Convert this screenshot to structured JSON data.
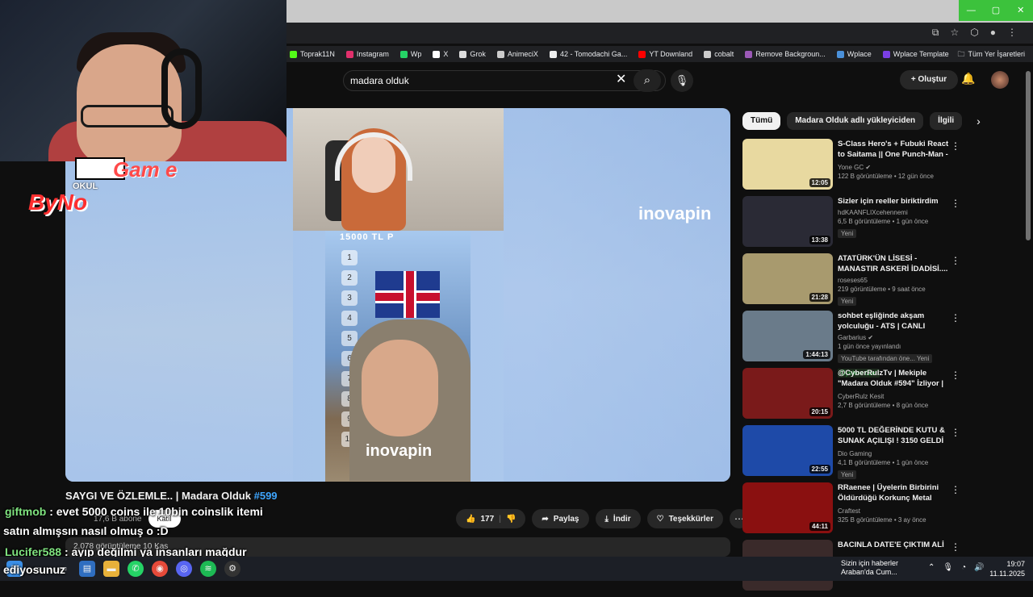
{
  "browser": {
    "window_controls": [
      "—",
      "▢",
      "✕"
    ],
    "bookmarks": [
      {
        "label": "Toprak11N",
        "color": "#53fc18"
      },
      {
        "label": "Instagram",
        "color": "#e1306c"
      },
      {
        "label": "Wp",
        "color": "#25d366"
      },
      {
        "label": "X",
        "color": "#ffffff"
      },
      {
        "label": "Grok",
        "color": "#ffffff"
      },
      {
        "label": "AnimeciX",
        "color": "#ffffff"
      },
      {
        "label": "42 - Tomodachi Ga...",
        "color": "#ffffff"
      },
      {
        "label": "YT Downland",
        "color": "#ff0000"
      },
      {
        "label": "cobalt",
        "color": "#ffffff"
      },
      {
        "label": "Remove Backgroun...",
        "color": "#9b59b6"
      },
      {
        "label": "Wplace",
        "color": "#4a90d9"
      },
      {
        "label": "Wplace Template",
        "color": "#7b3fe4"
      }
    ],
    "all_bookmarks": "Tüm Yer İşaretleri"
  },
  "header": {
    "search_value": "madara olduk",
    "create_label": "Oluştur"
  },
  "overlay": {
    "logo_okul": "OKUL",
    "logo_game": "Gam e",
    "logo_byno": "ByNo"
  },
  "video": {
    "reel_title": "15000 TL P",
    "reel_numbers": [
      "1",
      "2",
      "3",
      "4",
      "5",
      "6",
      "7",
      "8",
      "9",
      "10"
    ],
    "watermark": "inovapin",
    "watermark2": "inovapin",
    "title": "SAYGI VE ÖZLEMLE.. | Madara Olduk",
    "title_tag": "#599",
    "subscribers": "17,6 B abone",
    "join_label": "Katıl",
    "likes": "177",
    "share_label": "Paylaş",
    "download_label": "İndir",
    "thanks_label": "Teşekkürler",
    "description_meta": "2.078 görüntüleme  10 Kas"
  },
  "chat": [
    {
      "user": "giftmob",
      "text": ": evet 5000 coins ile 10bin coinslik itemi"
    },
    {
      "user": "",
      "text": "satın almışsın nasıl olmuş o :D"
    },
    {
      "user": "Lucifer588",
      "text": ": ayıp değilmi ya insanları mağdur"
    },
    {
      "user": "",
      "text": "ediyosunuz"
    }
  ],
  "chips": [
    "Tümü",
    "Madara Olduk adlı yükleyiciden",
    "İlgili"
  ],
  "related": [
    {
      "title": "S-Class Hero's + Fubuki React to Saitama || One Punch-Man - ...",
      "channel": "Yone GC ✔",
      "views": "122 B görüntüleme • 12 gün önce",
      "duration": "12:05",
      "thumb": "#e8d9a0",
      "badge": "",
      "member": ""
    },
    {
      "title": "Sizler için reeller biriktirdim",
      "channel": "hdKAANFLIXcehennemi",
      "views": "6,5 B görüntüleme • 1 gün önce",
      "duration": "13:38",
      "thumb": "#2a2a35",
      "badge": "Yeni",
      "member": ""
    },
    {
      "title": "ATATÜRK'ÜN LİSESİ - MANASTIR ASKERİ İDADİSİ....",
      "channel": "roseses65",
      "views": "219 görüntüleme • 9 saat önce",
      "duration": "21:28",
      "thumb": "#a89a6e",
      "badge": "Yeni",
      "member": ""
    },
    {
      "title": "sohbet eşliğinde akşam yolculuğu - ATS | CANLI",
      "channel": "Garbarius ✔",
      "views": "1 gün önce yayınlandı",
      "duration": "1:44:13",
      "thumb": "#6a7b8a",
      "badge": "YouTube tarafından öne...  Yeni",
      "member": "Üyelere özel"
    },
    {
      "title": "@CyberRulzTv | Mekiple \"Madara Olduk #594\" İzliyor | ...",
      "channel": "CyberRulz Kesit",
      "views": "2,7 B görüntüleme • 8 gün önce",
      "duration": "20:15",
      "thumb": "#7a1a1a",
      "badge": "",
      "member": ""
    },
    {
      "title": "5000 TL DEĞERİNDE KUTU & SUNAK AÇILIŞI ! 3150 GELDİ !!!",
      "channel": "Dio Gaming",
      "views": "4,1 B görüntüleme • 1 gün önce",
      "duration": "22:55",
      "thumb": "#1e4aa8",
      "badge": "Yeni",
      "member": ""
    },
    {
      "title": "RRaenee | Üyelerin Birbirini Öldürdüğü Korkunç Metal Gru...",
      "channel": "Craftest",
      "views": "325 B görüntüleme • 3 ay önce",
      "duration": "44:11",
      "thumb": "#8a1010",
      "badge": "",
      "member": ""
    },
    {
      "title": "BACINLA DATE'E ÇIKTIM ALİ",
      "channel": "",
      "views": "",
      "duration": "",
      "thumb": "#3a2a2a",
      "badge": "",
      "member": ""
    }
  ],
  "taskbar": {
    "news_line1": "Sizin için haberler",
    "news_line2": "Araban'da Cum...",
    "time": "19:07",
    "date": "11.11.2025"
  }
}
